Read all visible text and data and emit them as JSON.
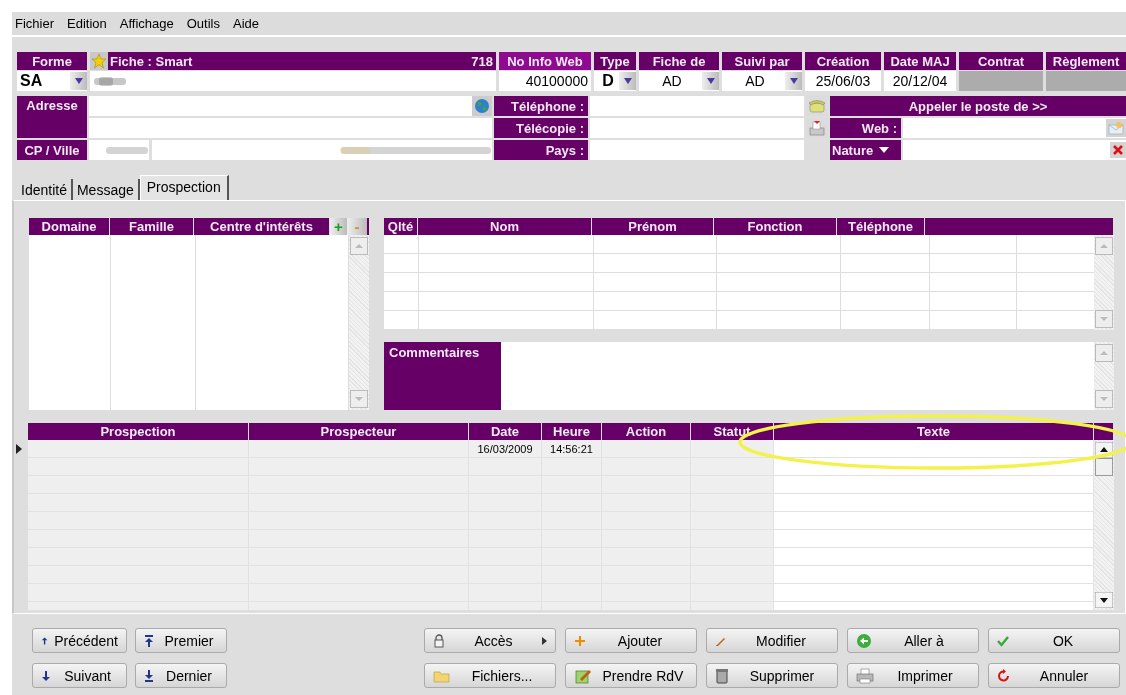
{
  "menu": [
    {
      "label": "Fichier"
    },
    {
      "label": "Edition"
    },
    {
      "label": "Affichage"
    },
    {
      "label": "Outils"
    },
    {
      "label": "Aide"
    }
  ],
  "header": {
    "forme": {
      "label": "Forme",
      "value": "SA"
    },
    "fiche": {
      "label": "Fiche : Smart",
      "number": "718",
      "blurred": true
    },
    "info_web": {
      "label": "No Info Web",
      "value": "40100000"
    },
    "columns": [
      {
        "label": "Type",
        "value": "D",
        "kind": "dropdown"
      },
      {
        "label": "Fiche de",
        "value": "AD",
        "kind": "dropdown"
      },
      {
        "label": "Suivi par",
        "value": "AD",
        "kind": "dropdown"
      },
      {
        "label": "Création",
        "value": "25/06/03",
        "kind": "text"
      },
      {
        "label": "Date MAJ",
        "value": "20/12/04",
        "kind": "text"
      },
      {
        "label": "Contrat",
        "kind": "disabled"
      },
      {
        "label": "Règlement",
        "kind": "disabled"
      }
    ]
  },
  "address": {
    "label": "Adresse",
    "cp_label": "CP / Ville",
    "cp_blurred": true,
    "city_blurred": true
  },
  "contact_labels": [
    "Téléphone :",
    "Télécopie :",
    "Pays :"
  ],
  "call_button": "Appeler le poste de >>",
  "web_label": "Web :",
  "nature_label": "Nature",
  "tabs": [
    {
      "label": "Identité",
      "selected": false
    },
    {
      "label": "Message",
      "selected": false
    },
    {
      "label": "Prospection",
      "selected": true
    }
  ],
  "interests": {
    "columns": [
      "Domaine",
      "Famille",
      "Centre d'intérêts"
    ],
    "add": "+",
    "remove": "-"
  },
  "contacts": {
    "columns": [
      "Qlté",
      "Nom",
      "Prénom",
      "Fonction",
      "Téléphone"
    ]
  },
  "comments_label": "Commentaires",
  "prospection": {
    "columns": [
      "Prospection",
      "Prospecteur",
      "Date",
      "Heure",
      "Action",
      "Statut",
      "Texte"
    ],
    "rows": [
      {
        "selected": true,
        "cells": [
          "",
          "",
          "16/03/2009",
          "14:56:21",
          "",
          "",
          ""
        ]
      }
    ]
  },
  "nav_buttons": [
    [
      "Précédent",
      "Premier"
    ],
    [
      "Suivant",
      "Dernier"
    ]
  ],
  "action_buttons": [
    [
      "Accès",
      "Ajouter",
      "Modifier",
      "Aller à",
      "OK"
    ],
    [
      "Fichiers...",
      "Prendre RdV",
      "Supprimer",
      "Imprimer",
      "Annuler"
    ]
  ]
}
